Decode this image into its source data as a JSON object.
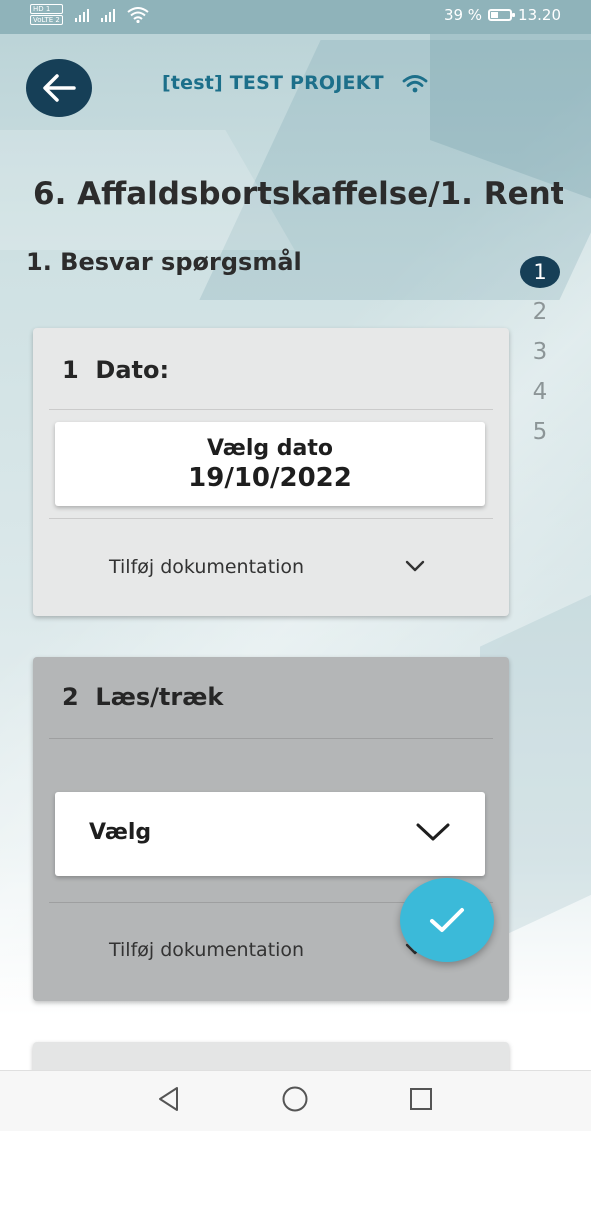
{
  "status_bar": {
    "network_badge_1": "HD 1",
    "network_badge_2": "VoLTE 2",
    "battery": "39 %",
    "battery_level": 0.39,
    "time": "13.20"
  },
  "header": {
    "back_icon": "arrow-left-icon",
    "project_title": "[test] TEST PROJEKT",
    "connection_icon": "wifi-icon"
  },
  "page_title": "6. Affaldsbortskaffelse/1. Rent ...",
  "section_title": "1. Besvar spørgsmål",
  "steps": [
    {
      "label": "1",
      "active": true
    },
    {
      "label": "2",
      "active": false
    },
    {
      "label": "3",
      "active": false
    },
    {
      "label": "4",
      "active": false
    },
    {
      "label": "5",
      "active": false
    }
  ],
  "questions": [
    {
      "number": "1",
      "title": "Dato:",
      "date_button_label": "Vælg dato",
      "date_value": "19/10/2022",
      "documentation_label": "Tilføj dokumentation"
    },
    {
      "number": "2",
      "title": "Læs/træk",
      "select_value": "Vælg",
      "documentation_label": "Tilføj dokumentation"
    }
  ],
  "fab": {
    "icon": "checkmark-icon"
  },
  "colors": {
    "primary_dark": "#163f57",
    "accent": "#3bbad9",
    "project_title": "#1c6f8a"
  },
  "nav_bar": {
    "back_icon": "triangle-back-icon",
    "home_icon": "circle-home-icon",
    "recents_icon": "square-recents-icon"
  }
}
